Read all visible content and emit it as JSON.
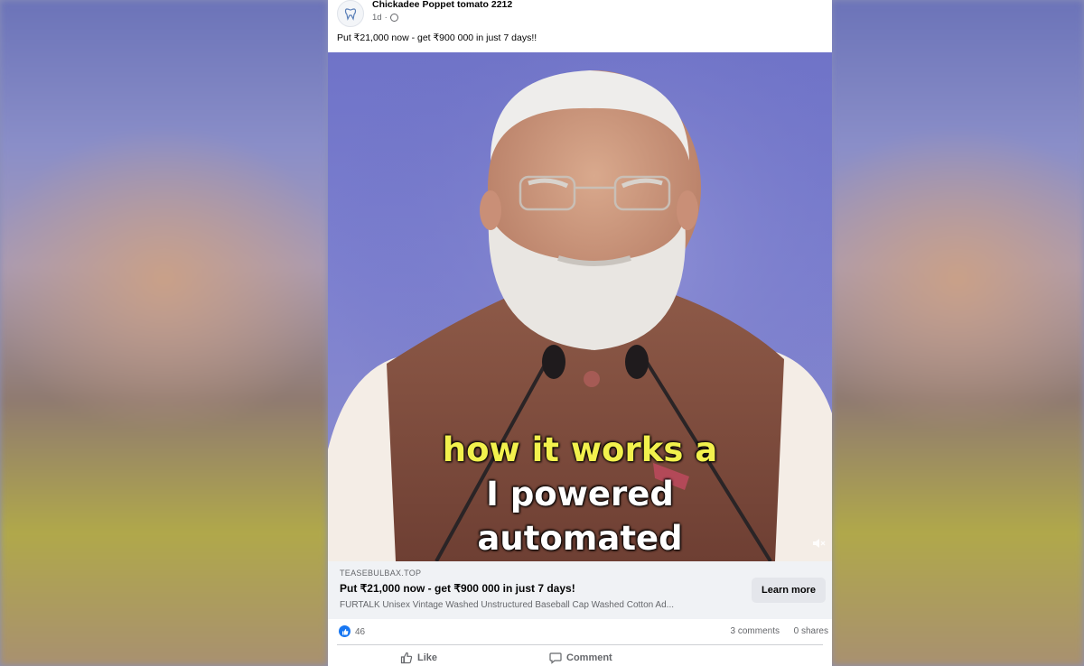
{
  "post": {
    "author": "Chickadee Poppet tomato 2212",
    "time": "1d",
    "caption": "Put ₹21,000 now - get ₹900 000 in just 7 days!!"
  },
  "video": {
    "subtitle_line1": "how it works a",
    "subtitle_line2": "I powered",
    "subtitle_line3": "automated",
    "subtitle_highlight_color": "#f2f14d",
    "volume_icon": "muted-speaker-icon"
  },
  "link_preview": {
    "domain": "TEASEBULBAX.TOP",
    "title": "Put ₹21,000 now - get ₹900 000 in just 7 days!",
    "description": "FURTALK Unisex Vintage Washed Unstructured Baseball Cap Washed Cotton Ad...",
    "button": "Learn more"
  },
  "stats": {
    "reaction_count": "46",
    "comments": "3 comments",
    "shares": "0 shares"
  },
  "actions": {
    "like": "Like",
    "comment": "Comment"
  },
  "colors": {
    "brand_blue": "#1877f2",
    "video_background": "#7d80cf"
  }
}
